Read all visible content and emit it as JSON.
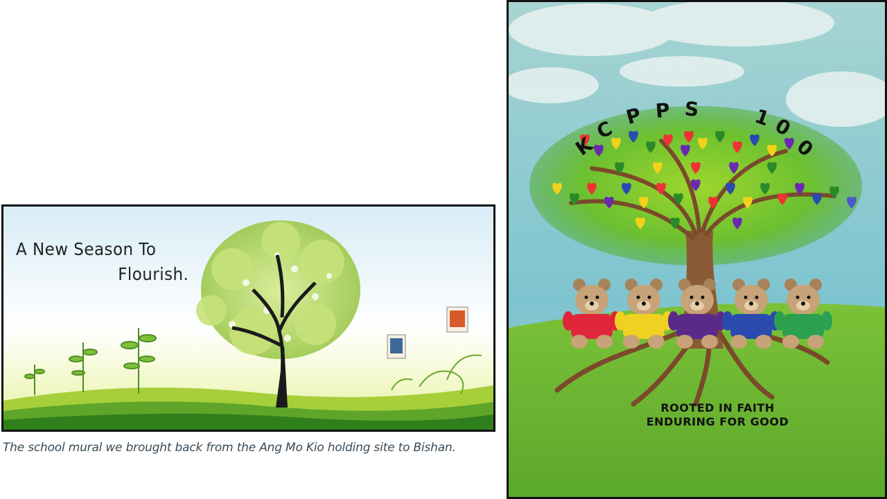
{
  "mural": {
    "title_line1": "A New Season To",
    "title_line2": "Flourish."
  },
  "caption": "The school mural we brought back from the Ang Mo Kio holding site to Bishan.",
  "poster": {
    "arc_letters": [
      "K",
      "C",
      "P",
      "P",
      "S",
      "1",
      "0",
      "0"
    ],
    "motto_line1": "ROOTED IN FAITH",
    "motto_line2": "ENDURING FOR GOOD",
    "bear_shirt_colors": [
      "#e0263a",
      "#f0d020",
      "#5a2a8a",
      "#2a4ab0",
      "#2aa050"
    ]
  }
}
